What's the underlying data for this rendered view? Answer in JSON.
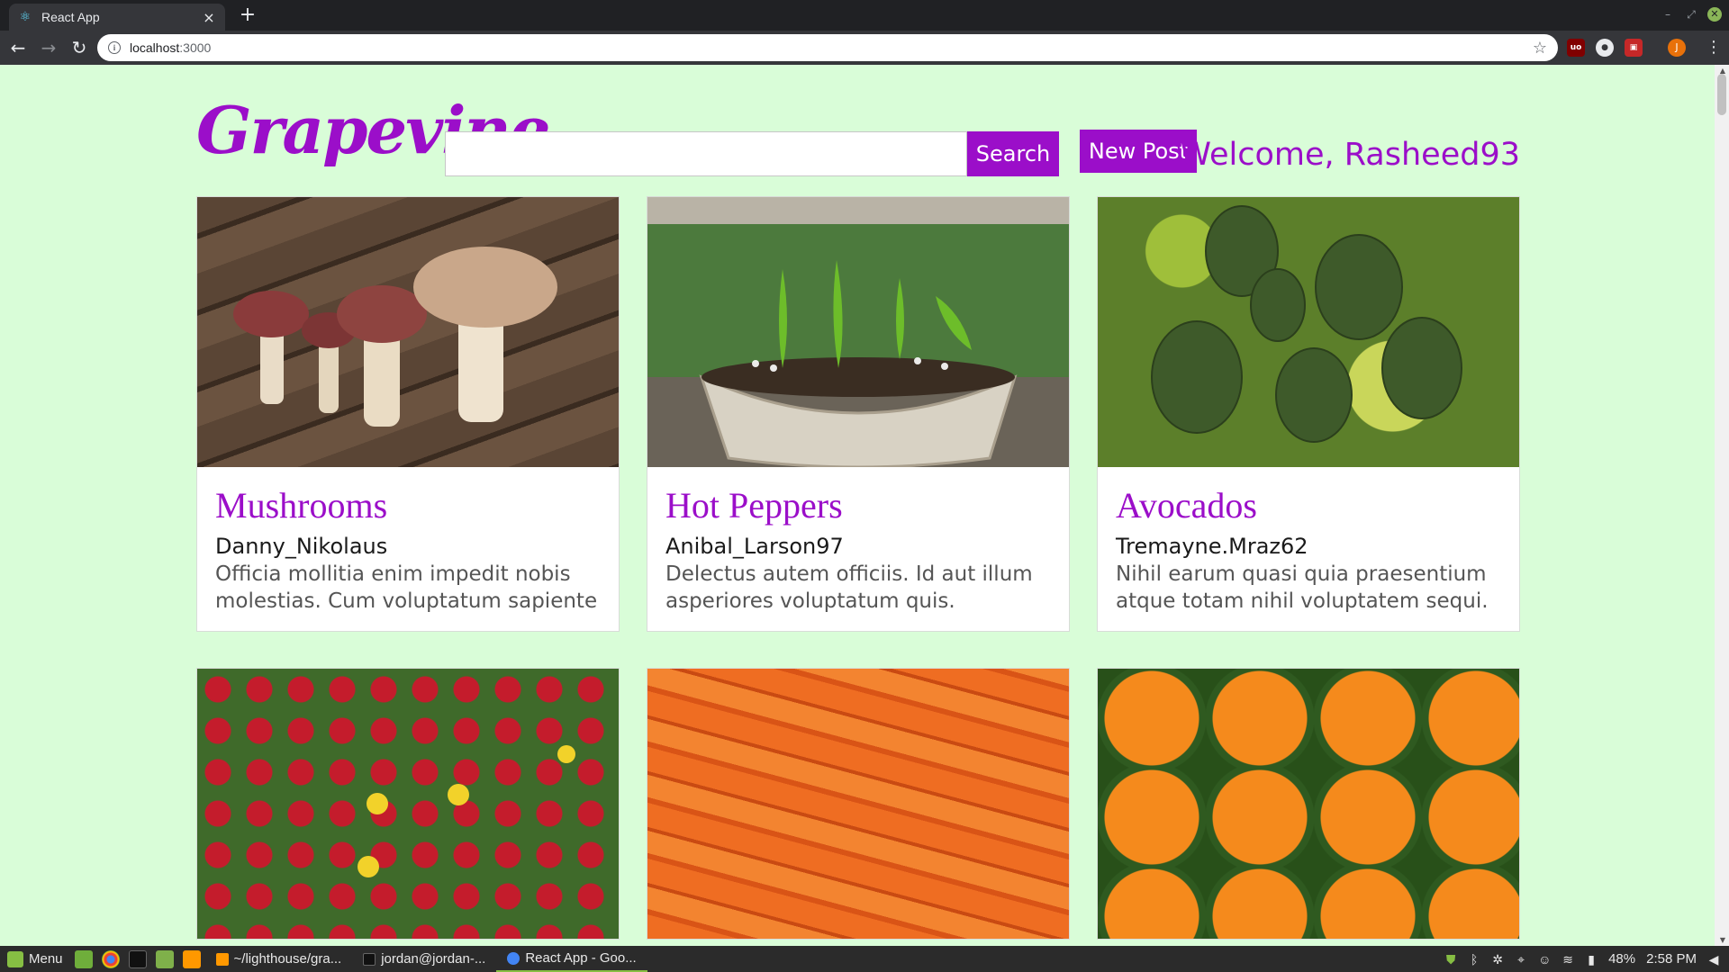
{
  "browser": {
    "tab_title": "React App",
    "tab_close": "×",
    "new_tab": "+",
    "url_host": "localhost",
    "url_port": ":3000"
  },
  "header": {
    "logo": "Grapevine",
    "search_placeholder": "",
    "search_label": "Search",
    "new_post_label": "New Post",
    "welcome": "Welcome, Rasheed93"
  },
  "posts": [
    {
      "title": "Mushrooms",
      "author": "Danny_Nikolaus",
      "text": "Officia mollitia enim impedit nobis molestias. Cum voluptatum sapiente",
      "image": "mushrooms"
    },
    {
      "title": "Hot Peppers",
      "author": "Anibal_Larson97",
      "text": "Delectus autem officiis. Id aut illum asperiores voluptatum quis.",
      "image": "peppers"
    },
    {
      "title": "Avocados",
      "author": "Tremayne.Mraz62",
      "text": "Nihil earum quasi quia praesentium atque totam nihil voluptatem sequi.",
      "image": "avocados"
    },
    {
      "title": "",
      "author": "",
      "text": "",
      "image": "strawberries"
    },
    {
      "title": "",
      "author": "",
      "text": "",
      "image": "carrots"
    },
    {
      "title": "",
      "author": "",
      "text": "",
      "image": "oranges"
    }
  ],
  "taskbar": {
    "menu_label": "Menu",
    "tasks": [
      {
        "label": "~/lighthouse/gra..."
      },
      {
        "label": "jordan@jordan-..."
      },
      {
        "label": "React App - Goo..."
      }
    ],
    "battery": "48%",
    "clock": "2:58 PM"
  },
  "colors": {
    "accent": "#9b0ec9",
    "page_bg": "#d9fdd8"
  }
}
